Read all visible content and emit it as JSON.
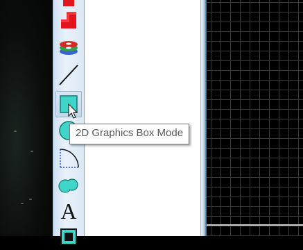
{
  "toolbar": {
    "tools": [
      {
        "icon": "red-square-icon"
      },
      {
        "icon": "red-polygon-icon"
      },
      {
        "icon": "layers-stack-icon"
      },
      {
        "icon": "line-tool-icon"
      },
      {
        "icon": "box-tool-icon",
        "active": true
      },
      {
        "icon": "circle-tool-icon"
      },
      {
        "icon": "arc-tool-icon"
      },
      {
        "icon": "blob-shape-icon"
      },
      {
        "icon": "text-tool-icon",
        "glyph": "A"
      },
      {
        "icon": "symbol-tool-icon"
      }
    ]
  },
  "tooltip": {
    "text": "2D Graphics Box Mode"
  },
  "colors": {
    "accent": "#3fd6c9",
    "toolbar_bg": "#e2edf8",
    "canvas_bg": "#000000",
    "grid": "#3b3b3b"
  }
}
